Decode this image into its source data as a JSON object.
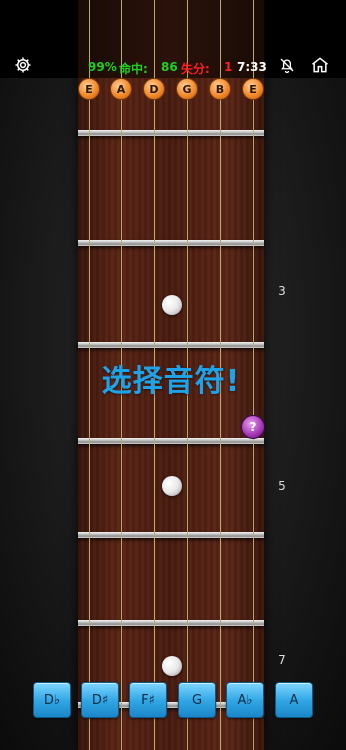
{
  "header": {
    "accuracy": "99%",
    "hits_label": "命中:",
    "hits_value": "86",
    "misses_label": "失分:",
    "misses_value": "1",
    "time": "7:33",
    "accent_green": "#1fd11f",
    "accent_red": "#ff2020",
    "icons": [
      "settings-gear-icon",
      "muted-bell-icon",
      "home-icon"
    ]
  },
  "strings": [
    "E",
    "A",
    "D",
    "G",
    "B",
    "E"
  ],
  "fret_numbers": [
    "3",
    "5",
    "7"
  ],
  "prompt": "选择音符!",
  "question_mark": "?",
  "answers": [
    "D♭",
    "D♯",
    "F♯",
    "G",
    "A♭",
    "A"
  ],
  "colors": {
    "prompt": "#1fa3e8",
    "answer_button": "#33a8e6",
    "string_marker": "#f28a2a",
    "question_marker": "#a83ab8"
  }
}
